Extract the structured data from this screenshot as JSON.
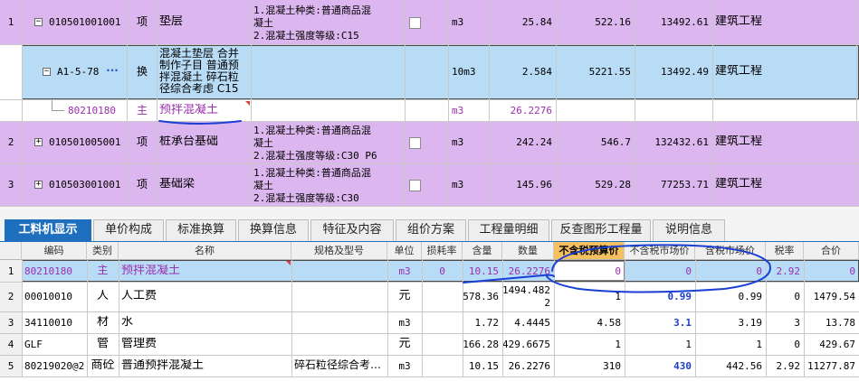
{
  "upper_rows": [
    {
      "num": "1",
      "code": "010501001001",
      "type": "项",
      "name": "垫层",
      "feature": [
        "1.混凝土种类:普通商品混",
        "凝土",
        "2.混凝土强度等级:C15"
      ],
      "unit": "m3",
      "qty": "25.84",
      "price": "522.16",
      "total": "13492.61",
      "category": "建筑工程",
      "expand": "−"
    },
    {
      "num": "",
      "code": "A1-5-78",
      "type": "换",
      "name": [
        "混凝土垫层  合并",
        "制作子目 普通预",
        "拌混凝土 碎石粒",
        "径综合考虑 C15"
      ],
      "unit": "10m3",
      "qty": "2.584",
      "price": "5221.55",
      "total": "13492.49",
      "category": "建筑工程",
      "expand": "−",
      "dots": "···"
    },
    {
      "num": "",
      "code": "80210180",
      "type": "主",
      "name": "预拌混凝土",
      "unit": "m3",
      "qty": "26.2276"
    },
    {
      "num": "2",
      "code": "010501005001",
      "type": "项",
      "name": "桩承台基础",
      "feature": [
        "1.混凝土种类:普通商品混",
        "凝土",
        "2.混凝土强度等级:C30 P6"
      ],
      "unit": "m3",
      "qty": "242.24",
      "price": "546.7",
      "total": "132432.61",
      "category": "建筑工程",
      "expand": "+"
    },
    {
      "num": "3",
      "code": "010503001001",
      "type": "项",
      "name": "基础梁",
      "feature": [
        "1.混凝土种类:普通商品混",
        "凝土",
        "2.混凝土强度等级:C30"
      ],
      "unit": "m3",
      "qty": "145.96",
      "price": "529.28",
      "total": "77253.71",
      "category": "建筑工程",
      "expand": "+"
    }
  ],
  "tabs": [
    "工料机显示",
    "单价构成",
    "标准换算",
    "换算信息",
    "特征及内容",
    "组价方案",
    "工程量明细",
    "反查图形工程量",
    "说明信息"
  ],
  "grid_headers": [
    "编码",
    "类别",
    "名称",
    "规格及型号",
    "单位",
    "损耗率",
    "含量",
    "数量",
    "不含税预算价",
    "不含税市场价",
    "含税市场价",
    "税率",
    "合价"
  ],
  "grid_rows": [
    {
      "num": "1",
      "code": "80210180",
      "type": "主",
      "name": "预拌混凝土",
      "spec": "",
      "unit": "m3",
      "loss": "0",
      "content": "10.15",
      "qty": "26.2276",
      "budget": "0",
      "market": "0",
      "tax_market": "0",
      "tax_rate": "2.92",
      "total": "0"
    },
    {
      "num": "2",
      "code": "00010010",
      "type": "人",
      "name": "人工费",
      "spec": "",
      "unit": "元",
      "loss": "",
      "content": "578.36",
      "qty": [
        "1494.482",
        "2"
      ],
      "budget": "1",
      "market": "0.99",
      "tax_market": "0.99",
      "tax_rate": "0",
      "total": "1479.54"
    },
    {
      "num": "3",
      "code": "34110010",
      "type": "材",
      "name": "水",
      "spec": "",
      "unit": "m3",
      "loss": "",
      "content": "1.72",
      "qty": "4.4445",
      "budget": "4.58",
      "market": "3.1",
      "tax_market": "3.19",
      "tax_rate": "3",
      "total": "13.78"
    },
    {
      "num": "4",
      "code": "GLF",
      "type": "管",
      "name": "管理费",
      "spec": "",
      "unit": "元",
      "loss": "",
      "content": "166.28",
      "qty": "429.6675",
      "budget": "1",
      "market": "1",
      "tax_market": "1",
      "tax_rate": "0",
      "total": "429.67"
    },
    {
      "num": "5",
      "code": "80219020@2",
      "type": "商砼",
      "name": "普通预拌混凝土",
      "spec": "碎石粒径综合考…",
      "unit": "m3",
      "loss": "",
      "content": "10.15",
      "qty": "26.2276",
      "budget": "310",
      "market": "430",
      "tax_market": "442.56",
      "tax_rate": "2.92",
      "total": "11277.87"
    }
  ],
  "colors": {
    "purple_row": "#dcb6ee",
    "blue_row": "#b8dbf6",
    "tab_active": "#1f6fbf",
    "annotation": "#1a3fd4",
    "orange_header": "#f5c060"
  }
}
